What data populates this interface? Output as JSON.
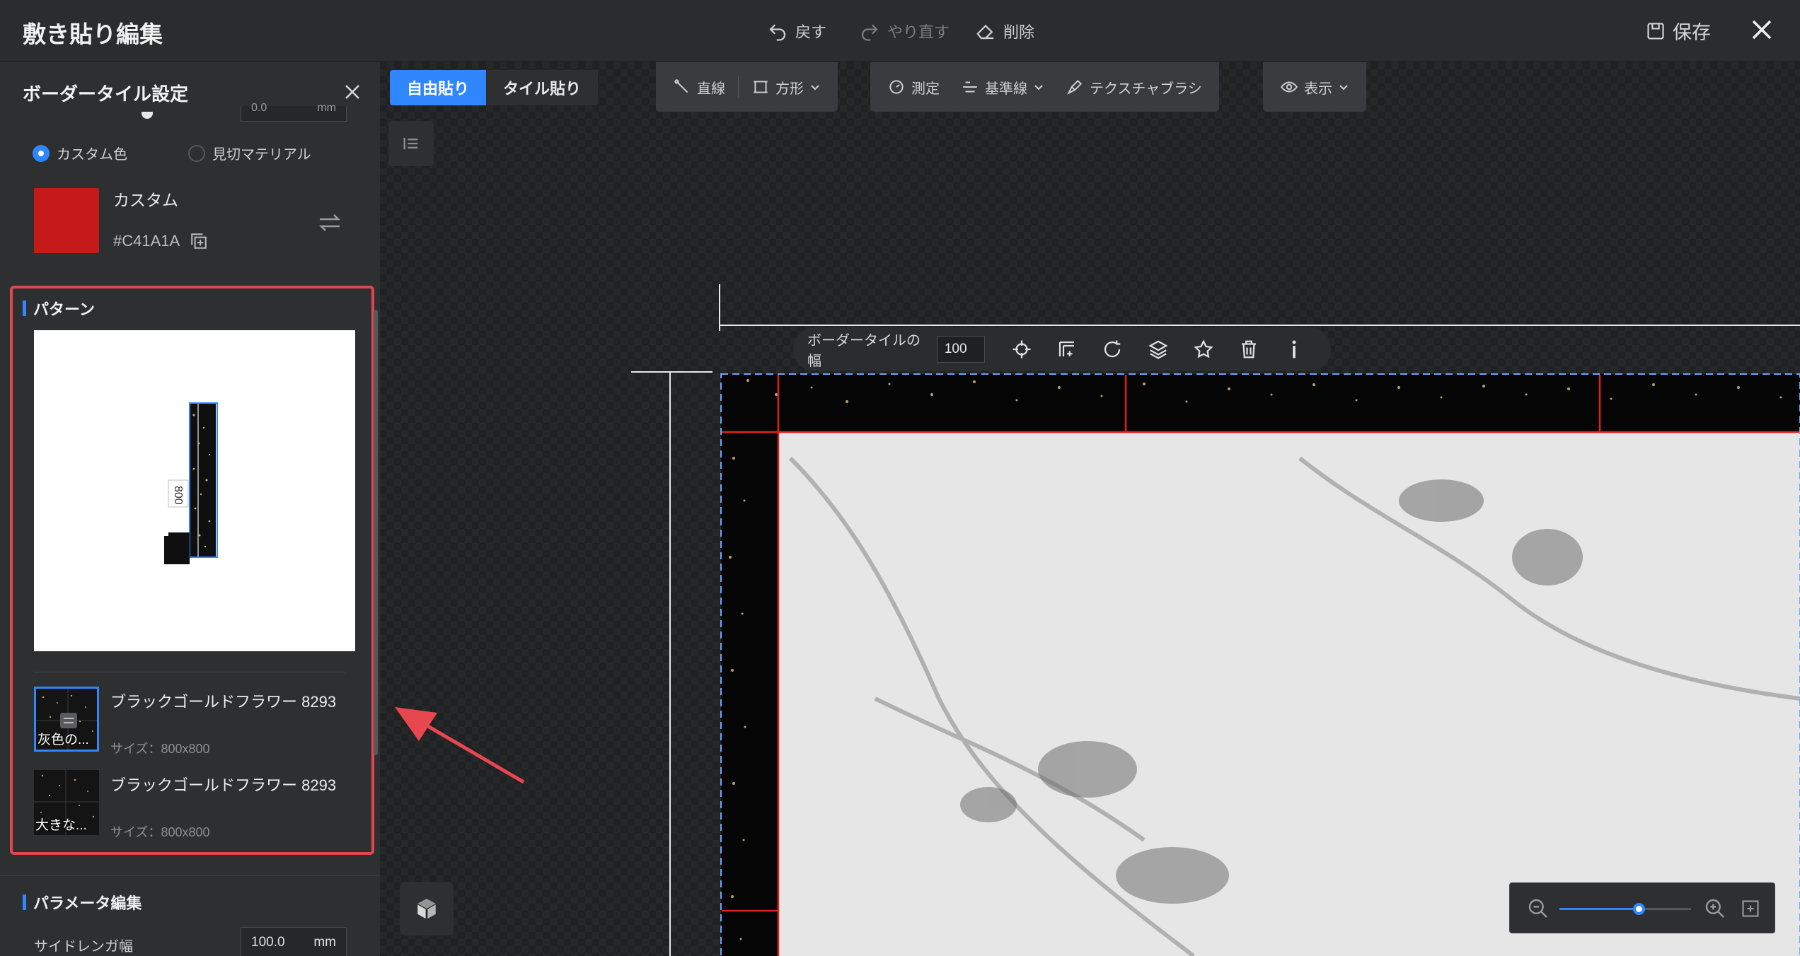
{
  "app": {
    "title": "敷き貼り編集"
  },
  "topbar": {
    "undo": "戻す",
    "redo": "やり直す",
    "delete": "削除",
    "save": "保存"
  },
  "panel": {
    "title": "ボーダータイル設定",
    "top_unit": "mm",
    "top_value": "0.0",
    "color_mode_options": [
      "カスタム色",
      "見切マテリアル"
    ],
    "color_mode_selected": "カスタム色",
    "color": {
      "label": "カスタム",
      "hex": "#C41A1A"
    },
    "pattern": {
      "title": "パターン",
      "dimension_label": "800",
      "items": [
        {
          "name": "ブラックゴールドフラワー 8293",
          "size": "サイズ：800x800",
          "caption": "灰色の...",
          "selected": true
        },
        {
          "name": "ブラックゴールドフラワー 8293",
          "size": "サイズ：800x800",
          "caption": "大きな...",
          "selected": false
        }
      ]
    },
    "params": {
      "title": "パラメータ編集",
      "side_brick_label": "サイドレンガ幅",
      "side_brick_value": "100.0",
      "side_brick_unit": "mm"
    }
  },
  "canvas": {
    "modes": [
      "自由貼り",
      "タイル貼り"
    ],
    "active_mode": "自由貼り",
    "tools_a": {
      "line": "直線",
      "rect": "方形"
    },
    "tools_b": {
      "measure": "測定",
      "guide": "基準線",
      "texture_brush": "テクスチャブラシ"
    },
    "tools_c": {
      "view": "表示"
    },
    "float_toolbar": {
      "label": "ボーダータイルの幅",
      "value": "100"
    },
    "zoom": {
      "level": 0.6
    }
  },
  "colors": {
    "accent": "#2f86ff",
    "highlight": "#e0464f",
    "border_line": "#e02020",
    "swatch": "#C41A1A"
  }
}
